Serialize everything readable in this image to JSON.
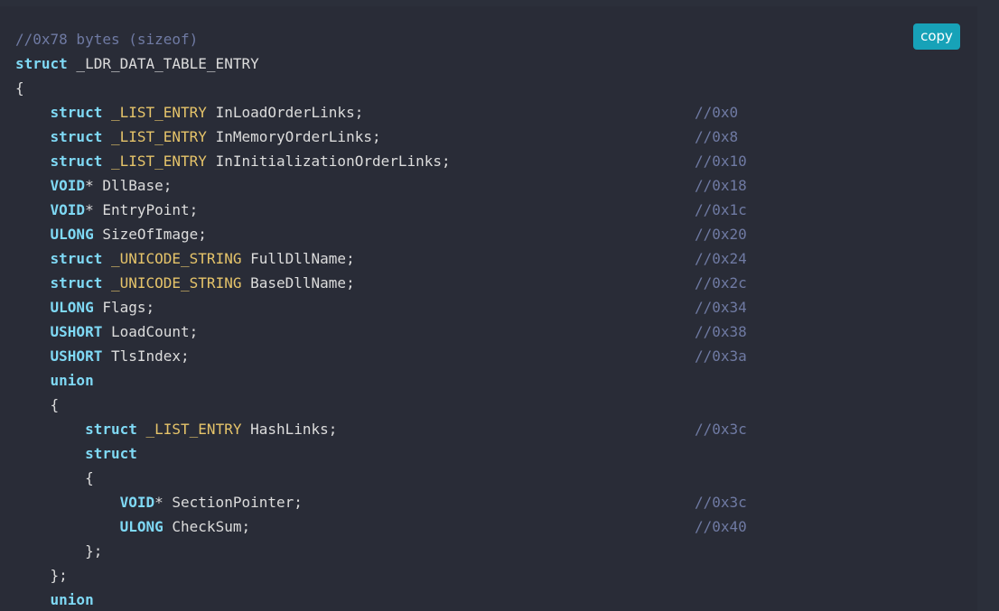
{
  "copy_button": {
    "label": "copy"
  },
  "code_lines": [
    {
      "indent": "",
      "parts": [
        {
          "cls": "cm",
          "text": "//0x78 bytes (sizeof)"
        }
      ],
      "comment": ""
    },
    {
      "indent": "",
      "parts": [
        {
          "cls": "kw",
          "text": "struct"
        },
        {
          "cls": "id",
          "text": " _LDR_DATA_TABLE_ENTRY"
        }
      ],
      "comment": ""
    },
    {
      "indent": "",
      "parts": [
        {
          "cls": "id",
          "text": "{"
        }
      ],
      "comment": ""
    },
    {
      "indent": "    ",
      "parts": [
        {
          "cls": "kw",
          "text": "struct"
        },
        {
          "cls": "id",
          "text": " "
        },
        {
          "cls": "ty",
          "text": "_LIST_ENTRY"
        },
        {
          "cls": "id",
          "text": " InLoadOrderLinks;"
        }
      ],
      "comment": "//0x0"
    },
    {
      "indent": "    ",
      "parts": [
        {
          "cls": "kw",
          "text": "struct"
        },
        {
          "cls": "id",
          "text": " "
        },
        {
          "cls": "ty",
          "text": "_LIST_ENTRY"
        },
        {
          "cls": "id",
          "text": " InMemoryOrderLinks;"
        }
      ],
      "comment": "//0x8"
    },
    {
      "indent": "    ",
      "parts": [
        {
          "cls": "kw",
          "text": "struct"
        },
        {
          "cls": "id",
          "text": " "
        },
        {
          "cls": "ty",
          "text": "_LIST_ENTRY"
        },
        {
          "cls": "id",
          "text": " InInitializationOrderLinks;"
        }
      ],
      "comment": "//0x10"
    },
    {
      "indent": "    ",
      "parts": [
        {
          "cls": "kw",
          "text": "VOID"
        },
        {
          "cls": "id",
          "text": "* DllBase;"
        }
      ],
      "comment": "//0x18"
    },
    {
      "indent": "    ",
      "parts": [
        {
          "cls": "kw",
          "text": "VOID"
        },
        {
          "cls": "id",
          "text": "* EntryPoint;"
        }
      ],
      "comment": "//0x1c"
    },
    {
      "indent": "    ",
      "parts": [
        {
          "cls": "kw",
          "text": "ULONG"
        },
        {
          "cls": "id",
          "text": " SizeOfImage;"
        }
      ],
      "comment": "//0x20"
    },
    {
      "indent": "    ",
      "parts": [
        {
          "cls": "kw",
          "text": "struct"
        },
        {
          "cls": "id",
          "text": " "
        },
        {
          "cls": "ty",
          "text": "_UNICODE_STRING"
        },
        {
          "cls": "id",
          "text": " FullDllName;"
        }
      ],
      "comment": "//0x24"
    },
    {
      "indent": "    ",
      "parts": [
        {
          "cls": "kw",
          "text": "struct"
        },
        {
          "cls": "id",
          "text": " "
        },
        {
          "cls": "ty",
          "text": "_UNICODE_STRING"
        },
        {
          "cls": "id",
          "text": " BaseDllName;"
        }
      ],
      "comment": "//0x2c"
    },
    {
      "indent": "    ",
      "parts": [
        {
          "cls": "kw",
          "text": "ULONG"
        },
        {
          "cls": "id",
          "text": " Flags;"
        }
      ],
      "comment": "//0x34"
    },
    {
      "indent": "    ",
      "parts": [
        {
          "cls": "kw",
          "text": "USHORT"
        },
        {
          "cls": "id",
          "text": " LoadCount;"
        }
      ],
      "comment": "//0x38"
    },
    {
      "indent": "    ",
      "parts": [
        {
          "cls": "kw",
          "text": "USHORT"
        },
        {
          "cls": "id",
          "text": " TlsIndex;"
        }
      ],
      "comment": "//0x3a"
    },
    {
      "indent": "    ",
      "parts": [
        {
          "cls": "kw",
          "text": "union"
        }
      ],
      "comment": ""
    },
    {
      "indent": "    ",
      "parts": [
        {
          "cls": "id",
          "text": "{"
        }
      ],
      "comment": ""
    },
    {
      "indent": "        ",
      "parts": [
        {
          "cls": "kw",
          "text": "struct"
        },
        {
          "cls": "id",
          "text": " "
        },
        {
          "cls": "ty",
          "text": "_LIST_ENTRY"
        },
        {
          "cls": "id",
          "text": " HashLinks;"
        }
      ],
      "comment": "//0x3c"
    },
    {
      "indent": "        ",
      "parts": [
        {
          "cls": "kw",
          "text": "struct"
        }
      ],
      "comment": ""
    },
    {
      "indent": "        ",
      "parts": [
        {
          "cls": "id",
          "text": "{"
        }
      ],
      "comment": ""
    },
    {
      "indent": "            ",
      "parts": [
        {
          "cls": "kw",
          "text": "VOID"
        },
        {
          "cls": "id",
          "text": "* SectionPointer;"
        }
      ],
      "comment": "//0x3c"
    },
    {
      "indent": "            ",
      "parts": [
        {
          "cls": "kw",
          "text": "ULONG"
        },
        {
          "cls": "id",
          "text": " CheckSum;"
        }
      ],
      "comment": "//0x40"
    },
    {
      "indent": "        ",
      "parts": [
        {
          "cls": "id",
          "text": "};"
        }
      ],
      "comment": ""
    },
    {
      "indent": "    ",
      "parts": [
        {
          "cls": "id",
          "text": "};"
        }
      ],
      "comment": ""
    },
    {
      "indent": "    ",
      "parts": [
        {
          "cls": "kw",
          "text": "union"
        }
      ],
      "comment": ""
    }
  ]
}
